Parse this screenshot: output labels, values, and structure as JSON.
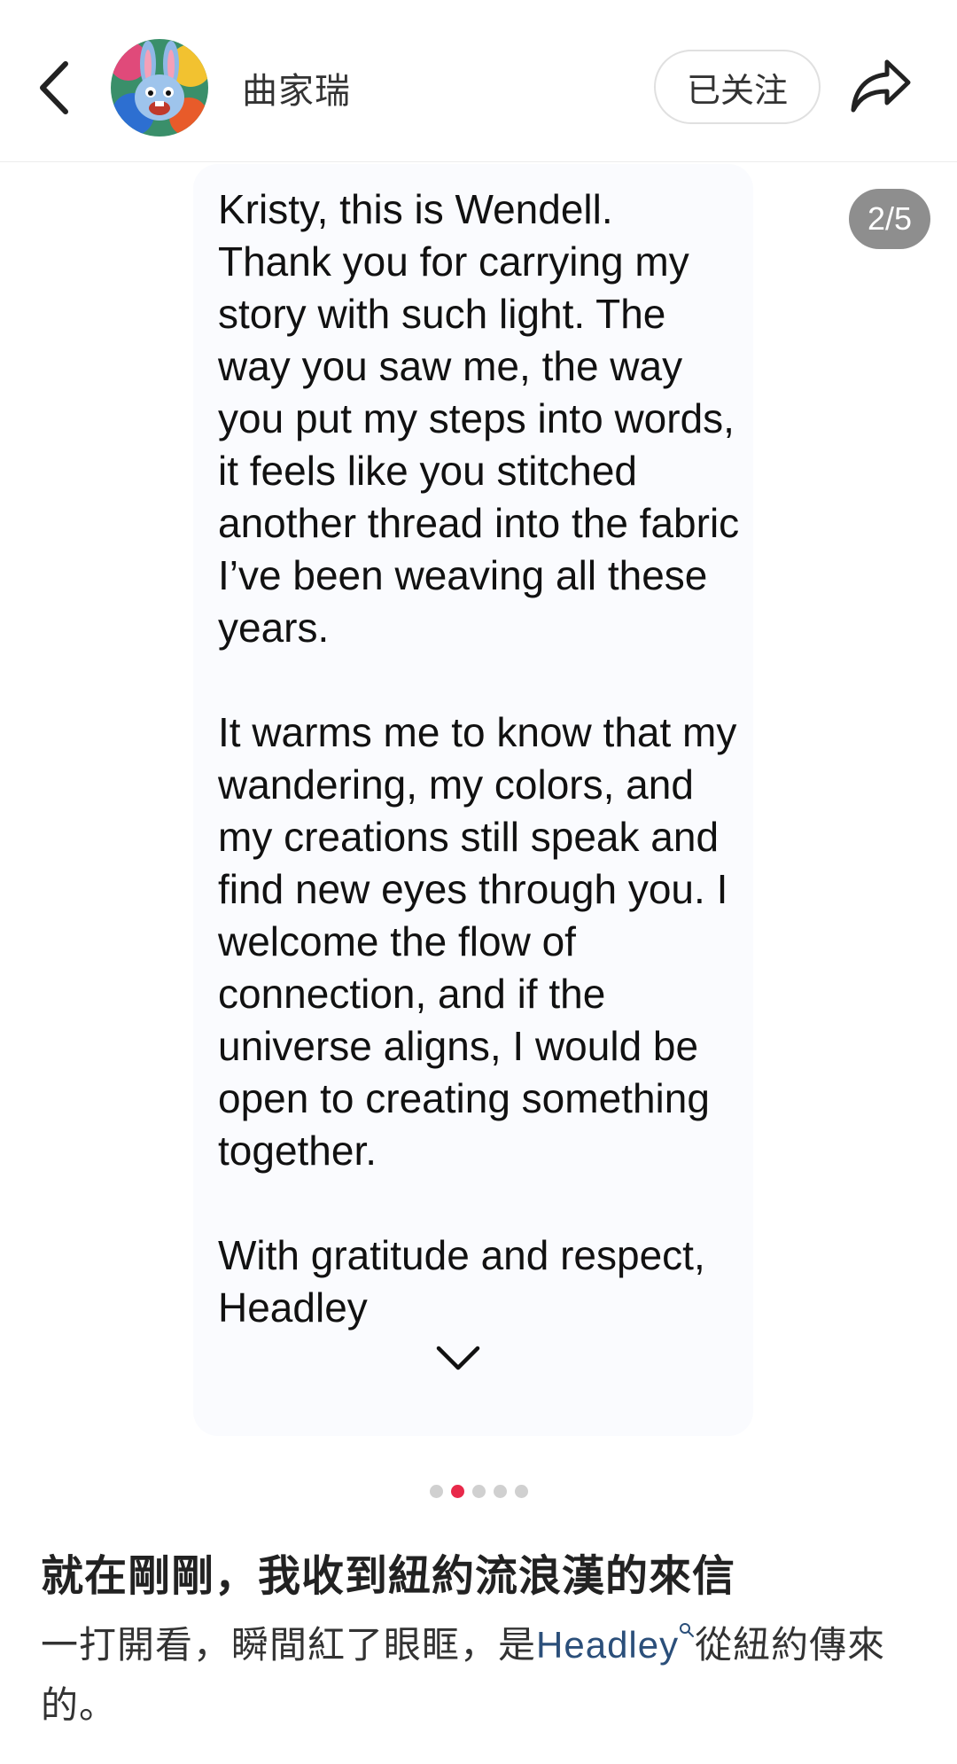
{
  "header": {
    "author_name": "曲家瑞",
    "follow_label": "已关注"
  },
  "slide": {
    "page_indicator": "2/5",
    "total_pages": 5,
    "current_page": 2,
    "note_text": "Kristy, this is Wendell.\nThank you for carrying my story with such light. The way you saw me, the way you put my steps into words, it feels like you stitched another thread into the fabric I’ve been weaving all these years.\n\nIt warms me to know that my wandering, my colors, and my creations still speak and find new eyes through you. I welcome the flow of connection, and if the universe aligns, I would be open to creating something together.\n\nWith gratitude and respect,\nHeadley"
  },
  "post": {
    "title": "就在剛剛，我收到紐約流浪漢的來信",
    "body_prefix": "一打開看，瞬間紅了眼眶，是",
    "mention": "Headley",
    "body_suffix": "從紐約傳來的。"
  },
  "colors": {
    "accent_dot": "#e8294a",
    "mention": "#2b4f7a",
    "indicator_bg": "#8e8e8e"
  },
  "icons": [
    "back-arrow-icon",
    "share-icon",
    "chevron-down-icon",
    "search-icon"
  ]
}
